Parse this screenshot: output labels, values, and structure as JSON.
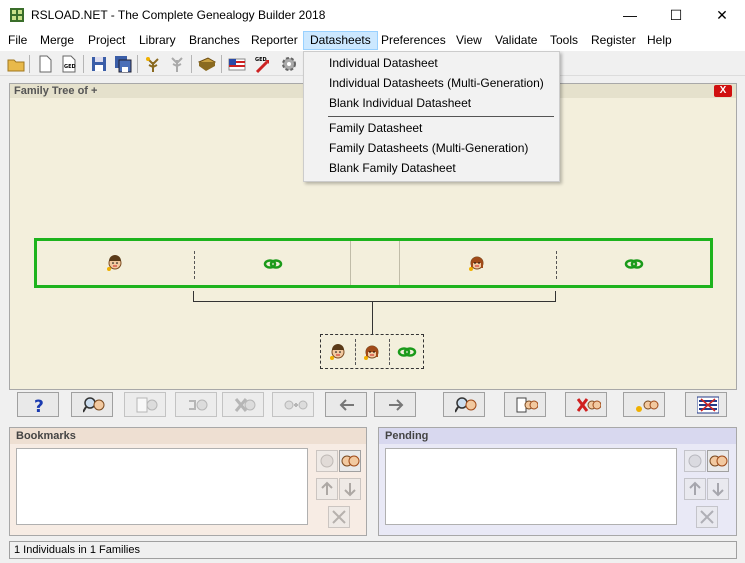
{
  "window": {
    "title": "RSLOAD.NET - The Complete Genealogy Builder 2018"
  },
  "window_controls": {
    "minimize": "—",
    "maximize": "☐",
    "close": "✕"
  },
  "menu": [
    "File",
    "Merge",
    "Project",
    "Library",
    "Branches",
    "Reporter",
    "Datasheets",
    "Preferences",
    "View",
    "Validate",
    "Tools",
    "Register",
    "Help"
  ],
  "active_menu": "Datasheets",
  "dropdown": {
    "items": [
      "Individual Datasheet",
      "Individual Datasheets (Multi-Generation)",
      "Blank Individual Datasheet",
      "Family Datasheet",
      "Family Datasheets (Multi-Generation)",
      "Blank Family Datasheet"
    ]
  },
  "tree": {
    "title": "Family Tree of +",
    "close_label": "X"
  },
  "bookmarks": {
    "title": "Bookmarks"
  },
  "pending": {
    "title": "Pending"
  },
  "status": {
    "text": "1 Individuals in 1 Families"
  },
  "toolbar_icons": [
    "open-folder-icon",
    "new-file-icon",
    "gedcom-icon",
    "save-icon",
    "save-all-icon",
    "tree-add-icon",
    "tree-icon",
    "book-icon",
    "flag-icon",
    "gedcom-export-icon",
    "settings-icon"
  ],
  "colors": {
    "tree_bg": "#f3efdc",
    "couple_border": "#1db31d",
    "bookmarks_bg": "#f7ece4",
    "pending_bg": "#e9e9f6",
    "active_menu_bg": "#cce8ff"
  }
}
